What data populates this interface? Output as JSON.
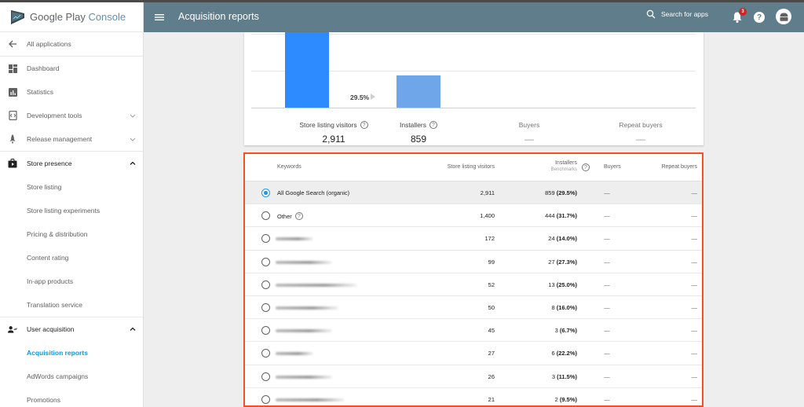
{
  "app": {
    "brand_main": "Google Play",
    "brand_sub": " Console",
    "page_title": "Acquisition reports"
  },
  "header": {
    "search_label": "Search for apps",
    "notification_count": "3",
    "help_label": "?"
  },
  "sidebar": {
    "back": {
      "label": "All applications",
      "icon": "arrow-left-icon"
    },
    "items": [
      {
        "label": "Dashboard",
        "icon": "dashboard-icon"
      },
      {
        "label": "Statistics",
        "icon": "statistics-icon"
      },
      {
        "label": "Development tools",
        "icon": "dev-tools-icon",
        "expandable": true
      },
      {
        "label": "Release management",
        "icon": "rocket-icon",
        "expandable": true
      }
    ],
    "store_presence": {
      "label": "Store presence",
      "icon": "store-bag-icon",
      "children": [
        "Store listing",
        "Store listing experiments",
        "Pricing & distribution",
        "Content rating",
        "In-app products",
        "Translation service"
      ]
    },
    "user_acquisition": {
      "label": "User acquisition",
      "icon": "user-acquisition-icon",
      "children": [
        "Acquisition reports",
        "AdWords campaigns",
        "Promotions"
      ],
      "active": "Acquisition reports"
    }
  },
  "funnel": {
    "conversion_label": "29.5%",
    "metrics": [
      {
        "label": "Store listing visitors",
        "value": "2,911",
        "help": true
      },
      {
        "label": "Installers",
        "value": "859",
        "help": true
      },
      {
        "label": "Buyers",
        "value": "—",
        "help": false
      },
      {
        "label": "Repeat buyers",
        "value": "—",
        "help": false
      }
    ],
    "colors": {
      "visitors": "#2e8bff",
      "installers": "#6fa6ea"
    }
  },
  "chart_data": {
    "type": "bar",
    "categories": [
      "Store listing visitors",
      "Installers",
      "Buyers",
      "Repeat buyers"
    ],
    "values": [
      2911,
      859,
      null,
      null
    ],
    "annotations": [
      {
        "between": [
          "Store listing visitors",
          "Installers"
        ],
        "text": "29.5%"
      }
    ],
    "title": "",
    "xlabel": "",
    "ylabel": "",
    "ylim": [
      0,
      2911
    ],
    "grid": true
  },
  "table": {
    "headers": {
      "keywords": "Keywords",
      "visitors": "Store listing visitors",
      "installers": "Installers",
      "benchmarks": "Benchmarks",
      "buyers": "Buyers",
      "repeat_buyers": "Repeat buyers"
    },
    "rows": [
      {
        "keyword": "All Google Search (organic)",
        "visitors": "2,911",
        "installers": "859",
        "rate": "(29.5%)",
        "buyers": "—",
        "repeat": "—",
        "selected": true
      },
      {
        "keyword": "Other",
        "visitors": "1,400",
        "installers": "444",
        "rate": "(31.7%)",
        "buyers": "—",
        "repeat": "—",
        "help": true
      },
      {
        "keyword": null,
        "visitors": "172",
        "installers": "24",
        "rate": "(14.0%)",
        "buyers": "—",
        "repeat": "—"
      },
      {
        "keyword": null,
        "visitors": "99",
        "installers": "27",
        "rate": "(27.3%)",
        "buyers": "—",
        "repeat": "—"
      },
      {
        "keyword": null,
        "visitors": "52",
        "installers": "13",
        "rate": "(25.0%)",
        "buyers": "—",
        "repeat": "—"
      },
      {
        "keyword": null,
        "visitors": "50",
        "installers": "8",
        "rate": "(16.0%)",
        "buyers": "—",
        "repeat": "—"
      },
      {
        "keyword": null,
        "visitors": "45",
        "installers": "3",
        "rate": "(6.7%)",
        "buyers": "—",
        "repeat": "—"
      },
      {
        "keyword": null,
        "visitors": "27",
        "installers": "6",
        "rate": "(22.2%)",
        "buyers": "—",
        "repeat": "—"
      },
      {
        "keyword": null,
        "visitors": "26",
        "installers": "3",
        "rate": "(11.5%)",
        "buyers": "—",
        "repeat": "—"
      },
      {
        "keyword": null,
        "visitors": "21",
        "installers": "2",
        "rate": "(9.5%)",
        "buyers": "—",
        "repeat": "—"
      }
    ],
    "highlight_color": "#f4511e"
  }
}
